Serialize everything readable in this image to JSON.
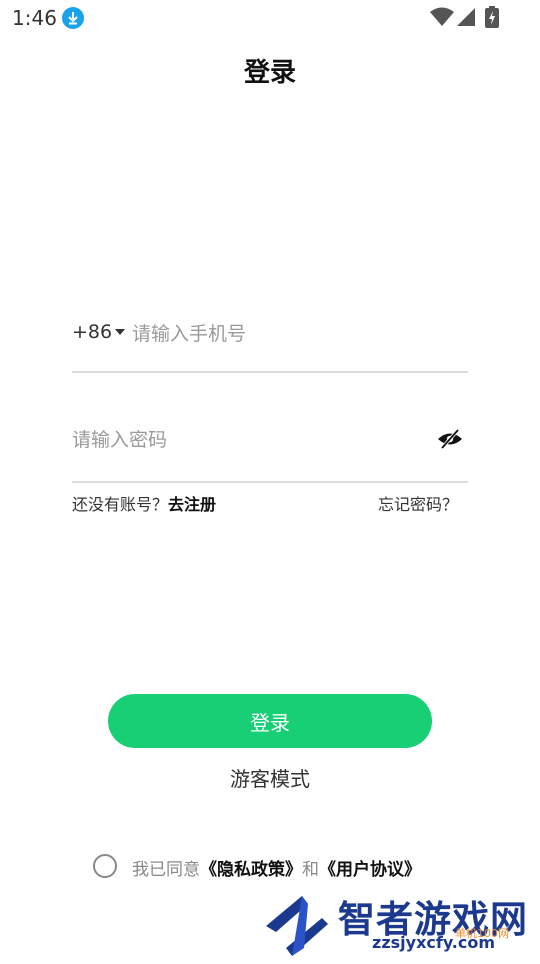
{
  "status_bar": {
    "time": "1:46",
    "download_icon": "download-icon",
    "wifi_icon": "wifi-icon",
    "signal_icon": "signal-icon",
    "battery_icon": "battery-icon"
  },
  "header": {
    "title": "登录"
  },
  "form": {
    "country_code": "+86",
    "phone_placeholder": "请输入手机号",
    "password_placeholder": "请输入密码",
    "eye_icon": "eye-off-icon"
  },
  "links": {
    "no_account": "还没有账号？",
    "register": "去注册",
    "forgot_password": "忘记密码？"
  },
  "actions": {
    "login_label": "登录",
    "guest_label": "游客模式"
  },
  "agreement": {
    "prefix": "我已同意",
    "privacy": "《隐私政策》",
    "and": "和",
    "terms": "《用户协议》"
  },
  "watermark": {
    "brand": "智者游戏网",
    "domain": "zzsjyxcfy.com",
    "sub": "单机100网"
  },
  "colors": {
    "accent": "#19cf76",
    "download_badge": "#1aa3e8",
    "watermark_blue": "#1b3a8f"
  }
}
